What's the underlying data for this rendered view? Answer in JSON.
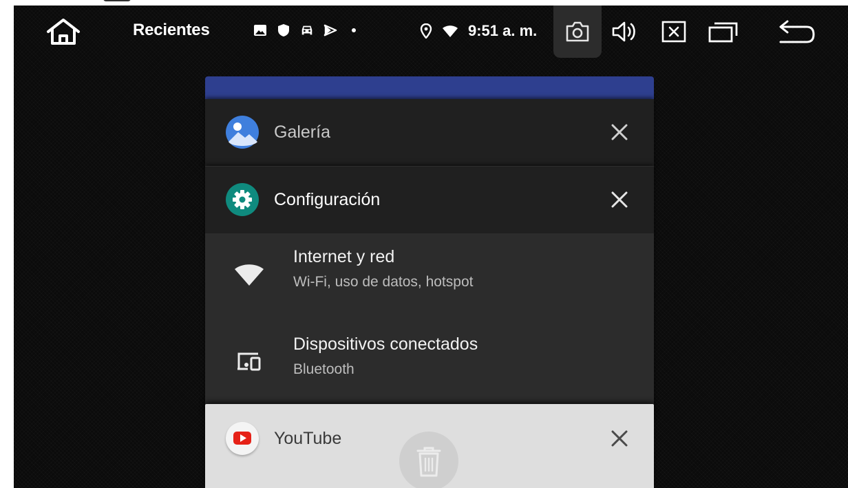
{
  "statusbar": {
    "title": "Recientes",
    "time": "9:51 a. m.",
    "notification_icons": [
      "gallery-icon",
      "shield-icon",
      "car-icon",
      "navigation-icon",
      "dot-icon"
    ],
    "system_icons": [
      "location-icon",
      "wifi-icon"
    ],
    "nav_buttons": [
      "home-icon",
      "screenshot-camera-icon",
      "volume-icon",
      "close-box-icon",
      "recents-icon",
      "back-icon"
    ]
  },
  "recents": {
    "cards": [
      {
        "app": "Galería",
        "icon": "gallery-app-icon"
      },
      {
        "app": "Configuración",
        "icon": "settings-app-icon"
      },
      {
        "app": "YouTube",
        "icon": "youtube-app-icon"
      }
    ],
    "settings_preview": [
      {
        "title": "Internet y red",
        "subtitle": "Wi-Fi, uso de datos, hotspot",
        "icon": "wifi-icon"
      },
      {
        "title": "Dispositivos conectados",
        "subtitle": "Bluetooth",
        "icon": "connected-devices-icon"
      }
    ],
    "clear_all_icon": "trash-icon"
  },
  "colors": {
    "background": "#0b0b0b",
    "card_dark": "#202020",
    "preview": "#2c2c2c",
    "card_light": "#dedede",
    "top_card_blue": "#2e3f8f",
    "settings_teal": "#0f8a7e",
    "gallery_blue": "#3f7fdd",
    "youtube_red": "#e62117"
  }
}
